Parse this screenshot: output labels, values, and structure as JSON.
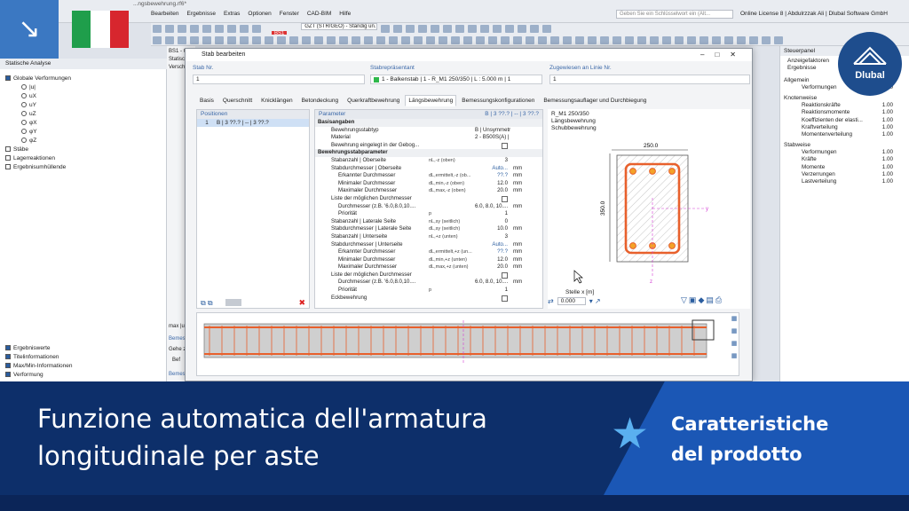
{
  "app": {
    "file_title": "...ngsbewehrung.rf6*",
    "menu": [
      "Bearbeiten",
      "Ergebnisse",
      "Extras",
      "Optionen",
      "Fenster",
      "CAD-BIM",
      "Hilfe"
    ],
    "search_placeholder": "Geben Sie ein Schlüsselwort ein (Alt...",
    "license": "Online License 8 | Abdulrzzak Ali | Dlubal Software GmbH",
    "loadcase_tag": "BS1",
    "loadcase_label": "GZT (STR/GEO) - Ständig un..."
  },
  "navigator": {
    "title": "Statische Analyse",
    "items": [
      {
        "label": "Globale Verformungen",
        "checked": true
      },
      {
        "label": "|u|",
        "radio": true
      },
      {
        "label": "uX",
        "radio": true
      },
      {
        "label": "uY",
        "radio": true
      },
      {
        "label": "uZ",
        "radio": true
      },
      {
        "label": "φX",
        "radio": true
      },
      {
        "label": "φY",
        "radio": true
      },
      {
        "label": "φZ",
        "radio": true
      },
      {
        "label": "Stäbe",
        "checked": false
      },
      {
        "label": "Lagerreaktionen",
        "checked": false
      },
      {
        "label": "Ergebnisumhüllende",
        "checked": false
      }
    ],
    "bottom_items": [
      {
        "label": "Ergebniswerte",
        "checked": true
      },
      {
        "label": "Titelinformationen",
        "checked": true
      },
      {
        "label": "Max/Min-Informationen",
        "checked": true
      },
      {
        "label": "Verformung",
        "checked": true
      }
    ]
  },
  "behind": {
    "lines": [
      "BS1 - G",
      "Statisc",
      "Versch"
    ],
    "maxlabel": "max |u|",
    "bemes": "Bemes",
    "gehe": "Gehe z",
    "bef": "Bef",
    "bemes2": "Bemes"
  },
  "dialog": {
    "title": "Stab bearbeiten",
    "stab_nr_label": "Stab Nr.",
    "stab_nr": "1",
    "repr_label": "Stabrepräsentant",
    "repr_value": "1 - Balkenstab | 1 - R_M1 250/350 | L : 5.000 m | 1",
    "assigned_label": "Zugewiesen an Linie Nr.",
    "assigned_value": "1",
    "tabs": [
      "Basis",
      "Querschnitt",
      "Knicklängen",
      "Betondeckung",
      "Querkraftbewehrung",
      "Längsbewehrung",
      "Bemessungskonfigurationen",
      "Bemessungsauflager und Durchbiegung"
    ],
    "active_tab": "Längsbewehrung",
    "positions_header": "Positionen",
    "positions": [
      {
        "nr": "1",
        "text": "B | 3 ??.? | -- | 3 ??.?"
      }
    ],
    "params_header": "Parameter",
    "params_header_right": "B | 3 ??.? | -- | 3 ??.?",
    "params": [
      {
        "n": "Basisangaben",
        "sec": true
      },
      {
        "n": "Bewehrungsstabtyp",
        "s": "",
        "v": "B | Unsymmetrisch",
        "u": ""
      },
      {
        "n": "Material",
        "s": "",
        "v": "2 - B500S(A) | Isotro...",
        "u": ""
      },
      {
        "n": "Bewehrung eingelegt in der Gebog...",
        "s": "",
        "v": "",
        "u": "",
        "check": true
      },
      {
        "n": "Bewehrungsstabparameter",
        "sec": true
      },
      {
        "n": "Stabanzahl | Oberseite",
        "s": "nL,-z (oben)",
        "v": "3",
        "u": ""
      },
      {
        "n": "Stabdurchmesser | Oberseite",
        "s": "",
        "v": "Auto...",
        "u": "mm"
      },
      {
        "n": "Erkannter Durchmesser",
        "s": "dL,ermittelt,-z (ob...",
        "v": "??.?",
        "u": "mm"
      },
      {
        "n": "Minimaler Durchmesser",
        "s": "dL,min,-z (oben)",
        "v": "12.0",
        "u": "mm"
      },
      {
        "n": "Maximaler Durchmesser",
        "s": "dL,max,-z (oben)",
        "v": "20.0",
        "u": "mm"
      },
      {
        "n": "Liste der möglichen Durchmesser",
        "s": "",
        "v": "",
        "u": "",
        "check": true
      },
      {
        "n": "Durchmesser (z.B. '6.0,8.0,10....",
        "s": "",
        "v": "6.0, 8.0, 10....",
        "u": "mm"
      },
      {
        "n": "Priorität",
        "s": "p",
        "v": "1",
        "u": ""
      },
      {
        "n": "Stabanzahl | Laterale Seite",
        "s": "nL,sy (seitlich)",
        "v": "0",
        "u": ""
      },
      {
        "n": "Stabdurchmesser | Laterale Seite",
        "s": "dL,sy (seitlich)",
        "v": "10.0",
        "u": "mm"
      },
      {
        "n": "Stabanzahl | Unterseite",
        "s": "nL,+z (unten)",
        "v": "3",
        "u": ""
      },
      {
        "n": "Stabdurchmesser | Unterseite",
        "s": "",
        "v": "Auto...",
        "u": "mm"
      },
      {
        "n": "Erkannter Durchmesser",
        "s": "dL,ermittelt,+z (un...",
        "v": "??.?",
        "u": "mm"
      },
      {
        "n": "Minimaler Durchmesser",
        "s": "dL,min,+z (unten)",
        "v": "12.0",
        "u": "mm"
      },
      {
        "n": "Maximaler Durchmesser",
        "s": "dL,max,+z (unten)",
        "v": "20.0",
        "u": "mm"
      },
      {
        "n": "Liste der möglichen Durchmesser",
        "s": "",
        "v": "",
        "u": "",
        "check": true
      },
      {
        "n": "Durchmesser (z.B. '6.0,8.0,10....",
        "s": "",
        "v": "6.0, 8.0, 10....",
        "u": "mm"
      },
      {
        "n": "Priorität",
        "s": "p",
        "v": "1",
        "u": ""
      },
      {
        "n": "Eckbewehrung",
        "s": "",
        "v": "",
        "u": "",
        "check": true
      }
    ],
    "section_label1": "R_M1 250/350",
    "section_label2": "Längsbewehrung",
    "section_label3": "Schubbewehrung",
    "dim_width": "250.0",
    "dim_height": "350.0",
    "axis_y": "y",
    "axis_z": "z",
    "stelle_label": "Stelle x [m]",
    "stelle_value": "0.000"
  },
  "rpanel": {
    "title": "Steuerpanel",
    "subtitle1": "Anzeigefaktoren",
    "subtitle2": "Ergebnisse",
    "sections": [
      {
        "title": "Allgemein",
        "rows": [
          [
            "Verformungen",
            "1.00"
          ]
        ]
      },
      {
        "title": "Knotenweise",
        "rows": [
          [
            "Reaktionskräfte",
            "1.00"
          ],
          [
            "Reaktionsmomente",
            "1.00"
          ],
          [
            "Koeffizienten der elasti...",
            "1.00"
          ],
          [
            "Kraftverteilung",
            "1.00"
          ],
          [
            "Momentenverteilung",
            "1.00"
          ]
        ]
      },
      {
        "title": "Stabweise",
        "rows": [
          [
            "Verformungen",
            "1.00"
          ],
          [
            "Kräfte",
            "1.00"
          ],
          [
            "Momente",
            "1.00"
          ],
          [
            "Verzerrungen",
            "1.00"
          ],
          [
            "Lastverteilung",
            "1.00"
          ]
        ]
      }
    ],
    "logo": "Dlubal"
  },
  "banner": {
    "title_line1": "Funzione automatica dell'armatura",
    "title_line2": "longitudinale per aste",
    "sub_line1": "Caratteristiche",
    "sub_line2": "del prodotto"
  },
  "colors": {
    "banner_dark": "#0d2f6a",
    "banner_light": "#1b57b5",
    "rebar": "#e8602c",
    "flag": [
      "#1f9e4b",
      "#ffffff",
      "#d7262e"
    ]
  }
}
